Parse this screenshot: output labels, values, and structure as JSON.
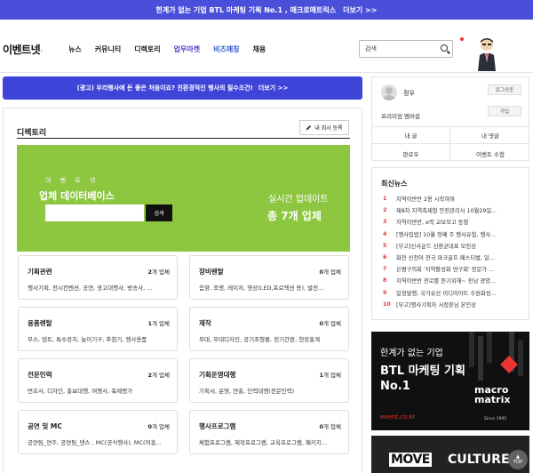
{
  "top_banner": {
    "text": "한계가 없는 기업 BTL 마케팅 기획 No.1 , 매크로매트릭스",
    "more": "더보기 >>"
  },
  "header": {
    "logo": "이벤트넷",
    "nav": [
      "뉴스",
      "커뮤니티",
      "디렉토리",
      "업무마켓",
      "비즈매칭",
      "채용"
    ],
    "search_value": "검색"
  },
  "ad_bar": {
    "text": "(광고) 우리행사에 돈 좋은 처음이죠? 친환경적인 행사의 필수조건!",
    "more": "더보기 >>"
  },
  "directory": {
    "title": "디렉토리",
    "register_label": "내 회사 등록",
    "db_small": "이 벤 트 넷",
    "db_title": "업체 데이터베이스",
    "search_button": "검색",
    "realtime_label": "실시간 업데이트",
    "total_label": "총 7개 업체",
    "categories": [
      {
        "name": "기획관련",
        "count": "2",
        "unit": "개 업체",
        "desc": "행사기획, 전시컨벤션, 공연, 광고대행사, 방송사, ..."
      },
      {
        "name": "장비렌탈",
        "count": "0",
        "unit": "개 업체",
        "desc": "음향, 조명, 레이저, 영상(LED,프로젝션 등), 발전..."
      },
      {
        "name": "용품렌탈",
        "count": "1",
        "unit": "개 업체",
        "desc": "무스, 텐트, 특수장치, 놀이기구, 추첨기, 행사용품"
      },
      {
        "name": "제작",
        "count": "0",
        "unit": "개 업체",
        "desc": "무대, 무대디자인, 공기조형물, 전기간판, 현장홍계"
      },
      {
        "name": "전문인력",
        "count": "2",
        "unit": "개 업체",
        "desc": "번호사, 디자인, 홍보대행, 여행사, 축제평가"
      },
      {
        "name": "기획운영대행",
        "count": "1",
        "unit": "개 업체",
        "desc": "기획서, 운영, 연출, 인력대행(전문인력)"
      },
      {
        "name": "공연 및 MC",
        "count": "0",
        "unit": "개 업체",
        "desc": "공연팀_연주, 공연팀_댄스 , MC(공식행사), MC(여흥..."
      },
      {
        "name": "행사프로그램",
        "count": "0",
        "unit": "개 업체",
        "desc": "체험프로그램, 제작프로그램, 교육프로그램, 패키지..."
      }
    ]
  },
  "login_box": {
    "user_name": "정우",
    "logout_label": "로그아웃",
    "premium_label": "프리미엄 멤버쉽",
    "join_label": "가입",
    "menu": [
      "내 글",
      "내 댓글",
      "판로우",
      "이벤트 수첩"
    ]
  },
  "news": {
    "title": "최신뉴스",
    "items": [
      {
        "no": "1",
        "text": "지역이반반 2용 시작하며"
      },
      {
        "no": "2",
        "text": "제8차 지역축제형 안전관리사 10월29일..."
      },
      {
        "no": "3",
        "text": "지역이반반, e력 교보모고 동향"
      },
      {
        "no": "4",
        "text": "[행사입법] 10월 첫째 주 행사유첩, 행사..."
      },
      {
        "no": "5",
        "text": "[부고]신사운드 신환균대표 모친상"
      },
      {
        "no": "6",
        "text": "화천 산천어 전국 파크골프 페스티벌, 일..."
      },
      {
        "no": "7",
        "text": "은평구의회 '지역활성화 연구회' 전문가 ..."
      },
      {
        "no": "8",
        "text": "지역이반반 전로를 듣기위해~ 전남 광양..."
      },
      {
        "no": "9",
        "text": "일정발행, 국가유산 미디어아트 수원화성..."
      },
      {
        "no": "10",
        "text": "[부고]행사기획자 서정훈님 본인상"
      }
    ]
  },
  "adv1": {
    "line1": "한계가 없는 기업",
    "line2": "BTL 마케팅 기획",
    "line3": "No.1",
    "site": "event.co.kr",
    "brand1": "macro",
    "brand2": "matrix",
    "since": "Since 1995"
  },
  "adv2": {
    "move": "MOVE",
    "culture": "CULTURE"
  },
  "top_button": {
    "arrow": "▲",
    "label": "TOP"
  },
  "colors": {
    "banner": "#4a4fd9",
    "green": "#8dc63f",
    "news_number": "#e23b3b"
  }
}
